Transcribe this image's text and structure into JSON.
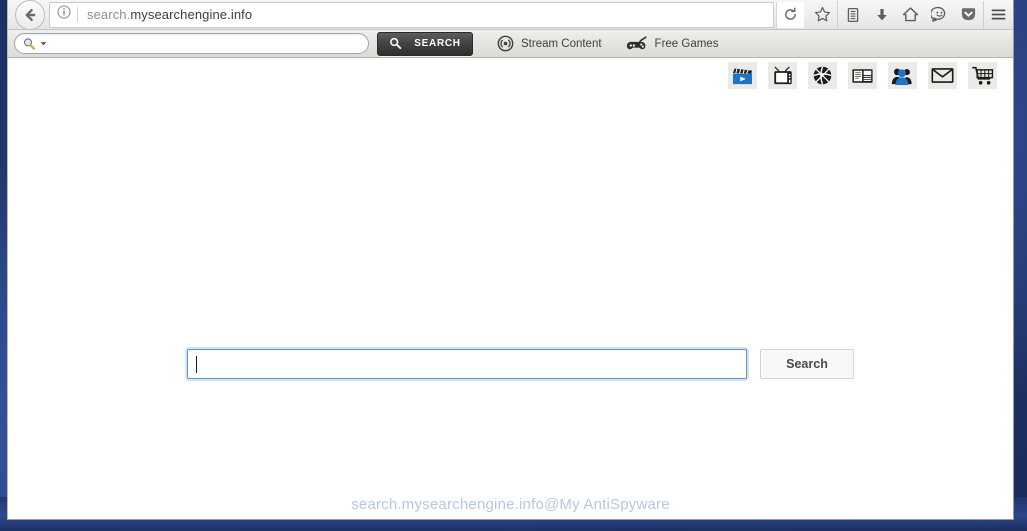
{
  "browser": {
    "url": "search.mysearchengine.info",
    "url_prefix": "search.",
    "url_domain": "mysearchengine.info",
    "back_icon": "back-arrow-icon",
    "identity_icon": "info-circle-icon",
    "reload_icon": "reload-icon",
    "toolbar_icons": [
      {
        "name": "bookmark-star-icon",
        "label": "Bookmark this page"
      },
      {
        "name": "library-icon",
        "label": "Show your library"
      },
      {
        "name": "downloads-icon",
        "label": "Downloads"
      },
      {
        "name": "home-icon",
        "label": "Home"
      },
      {
        "name": "account-smiley-icon",
        "label": "Account"
      },
      {
        "name": "pocket-icon",
        "label": "Save to Pocket"
      },
      {
        "name": "hamburger-menu-icon",
        "label": "Open menu"
      }
    ]
  },
  "addon_toolbar": {
    "search_placeholder": "",
    "search_value": "",
    "search_icon": "magnifier-icon",
    "dropdown_icon": "chevron-down-icon",
    "search_button_label": "SEARCH",
    "search_button_icon": "magnifier-icon",
    "links": [
      {
        "label": "Stream Content",
        "icon": "broadcast-icon"
      },
      {
        "label": "Free Games",
        "icon": "gamepad-icon"
      }
    ]
  },
  "page": {
    "category_icons": [
      {
        "name": "movie-clapperboard-icon",
        "label": "Movies"
      },
      {
        "name": "tv-icon",
        "label": "TV"
      },
      {
        "name": "basketball-icon",
        "label": "Sports"
      },
      {
        "name": "newspaper-icon",
        "label": "News"
      },
      {
        "name": "people-icon",
        "label": "Social"
      },
      {
        "name": "envelope-icon",
        "label": "Mail"
      },
      {
        "name": "shopping-cart-icon",
        "label": "Shopping"
      }
    ],
    "search_input_value": "",
    "search_input_placeholder": "",
    "search_button_label": "Search",
    "watermark": "search.mysearchengine.info@My AntiSpyware"
  },
  "colors": {
    "focus_border": "#5b93d6",
    "accent_blue": "#1b74c8",
    "desktop": "#2a4383",
    "toolbar_dark": "#3a3a3a"
  }
}
